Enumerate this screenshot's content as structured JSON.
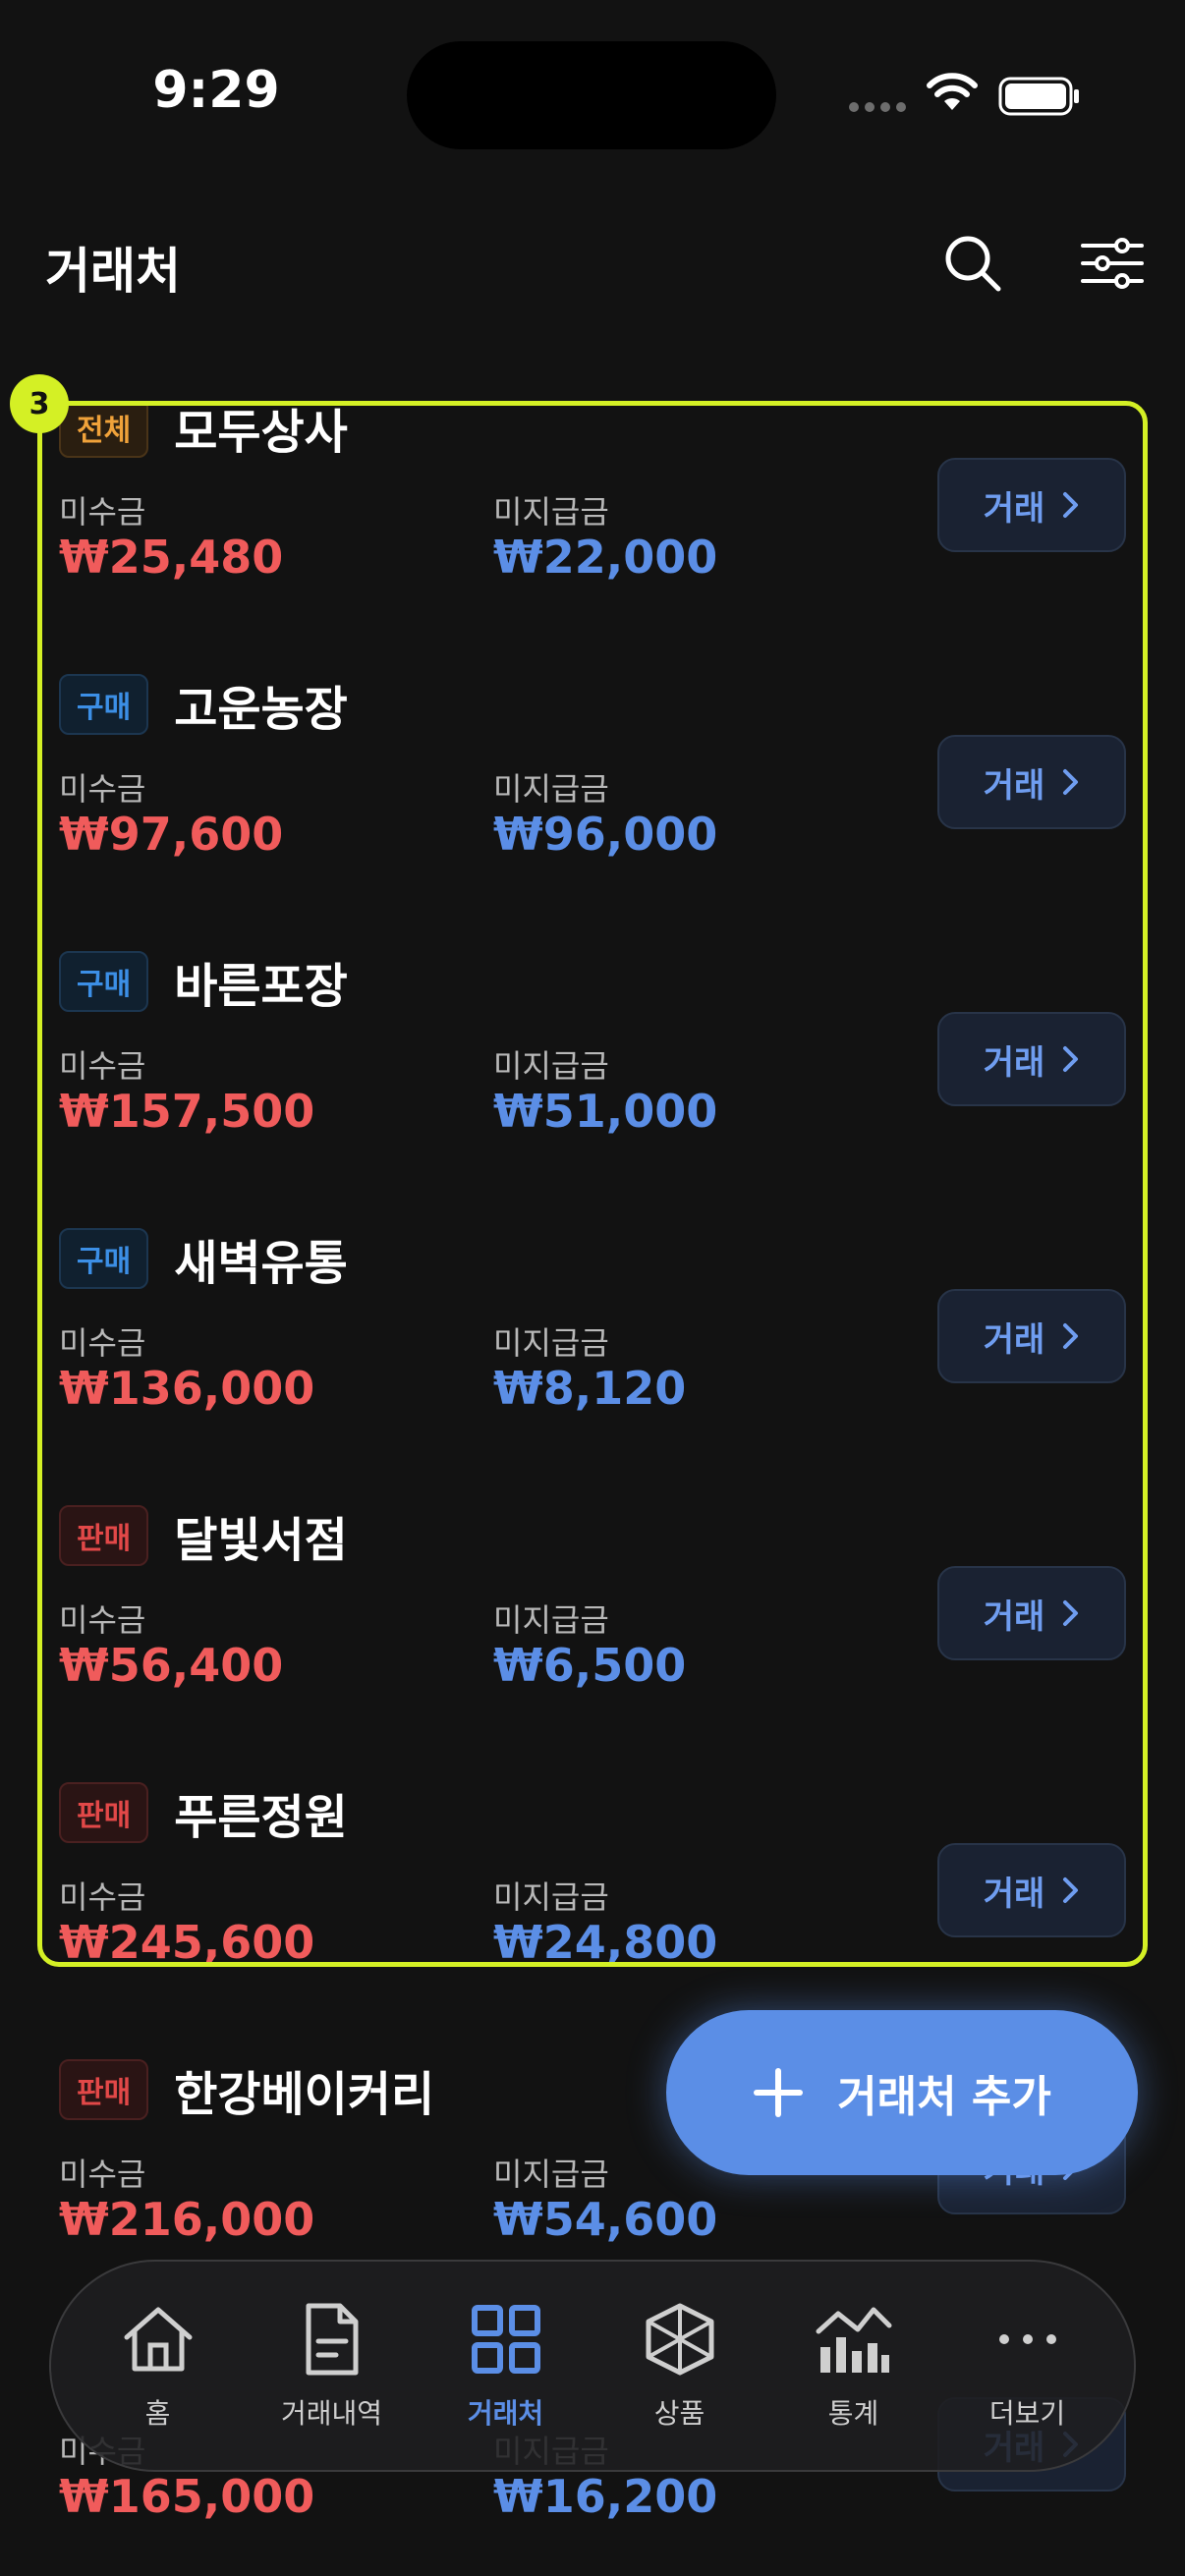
{
  "status": {
    "time": "9:29"
  },
  "header": {
    "title": "거래처"
  },
  "highlight": {
    "badge": "3"
  },
  "labels": {
    "receivable": "미수금",
    "payable": "미지급금",
    "trade_button": "거래"
  },
  "vendors": [
    {
      "tag": "전체",
      "tag_type": "all",
      "name": "모두상사",
      "receivable": "₩25,480",
      "payable": "₩22,000"
    },
    {
      "tag": "구매",
      "tag_type": "buy",
      "name": "고운농장",
      "receivable": "₩97,600",
      "payable": "₩96,000"
    },
    {
      "tag": "구매",
      "tag_type": "buy",
      "name": "바른포장",
      "receivable": "₩157,500",
      "payable": "₩51,000"
    },
    {
      "tag": "구매",
      "tag_type": "buy",
      "name": "새벽유통",
      "receivable": "₩136,000",
      "payable": "₩8,120"
    },
    {
      "tag": "판매",
      "tag_type": "sell",
      "name": "달빛서점",
      "receivable": "₩56,400",
      "payable": "₩6,500"
    },
    {
      "tag": "판매",
      "tag_type": "sell",
      "name": "푸른정원",
      "receivable": "₩245,600",
      "payable": "₩24,800"
    },
    {
      "tag": "판매",
      "tag_type": "sell",
      "name": "한강베이커리",
      "receivable": "₩216,000",
      "payable": "₩54,600"
    },
    {
      "tag": "",
      "tag_type": "sell",
      "name": "",
      "receivable": "₩165,000",
      "payable": "₩16,200"
    }
  ],
  "fab": {
    "label": "거래처 추가"
  },
  "nav": [
    {
      "label": "홈",
      "icon": "home-icon"
    },
    {
      "label": "거래내역",
      "icon": "document-icon"
    },
    {
      "label": "거래처",
      "icon": "grid-icon",
      "active": true
    },
    {
      "label": "상품",
      "icon": "box-icon"
    },
    {
      "label": "통계",
      "icon": "chart-icon"
    },
    {
      "label": "더보기",
      "icon": "more-icon"
    }
  ],
  "colors": {
    "accent": "#5b8ee6",
    "receivable": "#f05b5b",
    "payable": "#5b8ee6",
    "highlight": "#d4f025",
    "background": "#121212"
  }
}
